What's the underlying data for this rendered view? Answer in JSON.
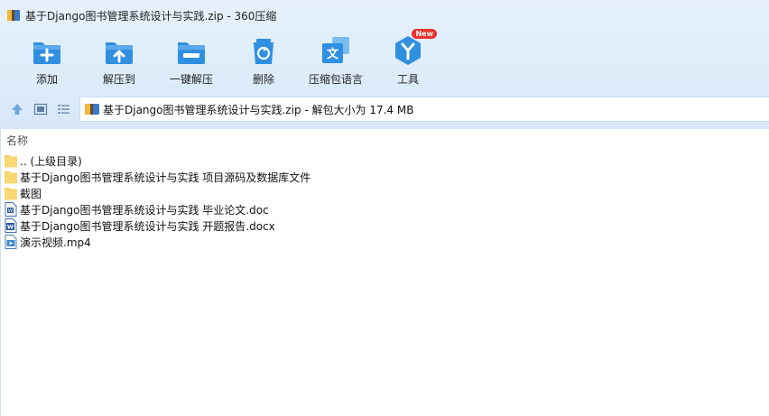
{
  "window": {
    "title": "基于Django图书管理系统设计与实践.zip - 360压缩"
  },
  "toolbar": {
    "items": [
      {
        "label": "添加",
        "icon": "add-icon"
      },
      {
        "label": "解压到",
        "icon": "extract-to-icon"
      },
      {
        "label": "一键解压",
        "icon": "one-click-extract-icon"
      },
      {
        "label": "删除",
        "icon": "delete-icon"
      },
      {
        "label": "压缩包语言",
        "icon": "archive-language-icon"
      },
      {
        "label": "工具",
        "icon": "tools-icon",
        "badge": "New"
      }
    ]
  },
  "navbar": {
    "path": "基于Django图书管理系统设计与实践.zip - 解包大小为 17.4 MB"
  },
  "filelist": {
    "column_header": "名称",
    "items": [
      {
        "name": ".. (上级目录)",
        "icon": "folder-icon"
      },
      {
        "name": "基于Django图书管理系统设计与实践 项目源码及数据库文件",
        "icon": "folder-icon"
      },
      {
        "name": "截图",
        "icon": "folder-icon"
      },
      {
        "name": "基于Django图书管理系统设计与实践 毕业论文.doc",
        "icon": "doc-file-icon"
      },
      {
        "name": "基于Django图书管理系统设计与实践 开题报告.docx",
        "icon": "docx-file-icon"
      },
      {
        "name": "演示视频.mp4",
        "icon": "video-file-icon"
      }
    ]
  },
  "colors": {
    "accent": "#2f8fe0",
    "folder": "#f5cd5c",
    "badge": "#e8322c"
  }
}
